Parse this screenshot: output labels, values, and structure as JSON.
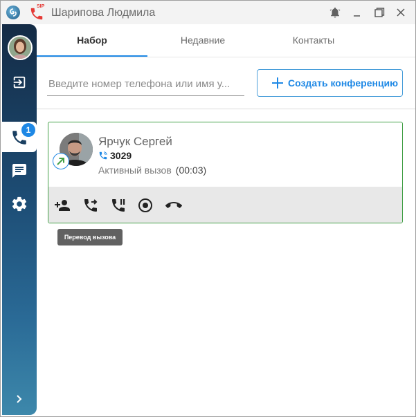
{
  "titlebar": {
    "title": "Шарипова Людмила",
    "sip_label": "SIP",
    "icons": [
      "app-logo-icon",
      "sip-phone-icon",
      "bell-icon",
      "minimize-icon",
      "maximize-icon",
      "close-icon"
    ]
  },
  "sidebar": {
    "items": [
      {
        "name": "user-avatar"
      },
      {
        "name": "logout",
        "icon": "logout-icon"
      },
      {
        "name": "calls",
        "icon": "phone-icon",
        "badge": "1",
        "active": true
      },
      {
        "name": "chat",
        "icon": "chat-icon"
      },
      {
        "name": "settings",
        "icon": "gear-icon"
      },
      {
        "name": "expand",
        "icon": "chevron-right-icon"
      }
    ]
  },
  "tabs": [
    {
      "label": "Набор",
      "active": true
    },
    {
      "label": "Недавние"
    },
    {
      "label": "Контакты"
    }
  ],
  "search": {
    "placeholder": "Введите номер телефона или имя у...",
    "value": ""
  },
  "conference_button": {
    "label": "Создать конференцию",
    "icon": "plus-icon"
  },
  "call": {
    "name": "Ярчук Сергей",
    "number": "3029",
    "status": "Активный вызов",
    "timer": "(00:03)",
    "direction_icon": "outgoing-call-arrow-icon",
    "actions": [
      "add-participant-icon",
      "transfer-call-icon",
      "hold-call-icon",
      "record-icon",
      "hangup-icon"
    ]
  },
  "tooltip": {
    "text": "Перевод вызова"
  },
  "colors": {
    "accent": "#1e88e5",
    "active_call_border": "#43a047",
    "hangup": "#222222",
    "sip_red": "#e53935"
  }
}
